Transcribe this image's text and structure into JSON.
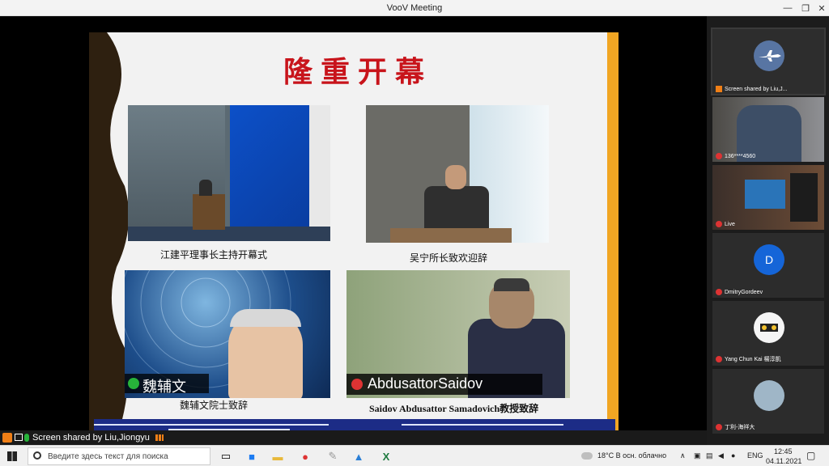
{
  "window": {
    "title": "VooV Meeting",
    "minimize": "—",
    "restore": "❐",
    "close": "✕"
  },
  "slide": {
    "title": "隆重开幕",
    "captions": [
      "江建平理事长主持开幕式",
      "吴宁所长致欢迎辞",
      "魏辅文院士致辞",
      "Saidov Abdusattor Samadovich教授致辞"
    ],
    "name_tags": [
      "魏辅文",
      "AbdusattorSaidov"
    ]
  },
  "share_bar": {
    "label": "Screen shared by Liu,Jiongyu"
  },
  "participants": [
    {
      "name": "Screen shared by Liu,J...",
      "kind": "plane"
    },
    {
      "name": "136****4560",
      "kind": "video"
    },
    {
      "name": "Live",
      "kind": "room"
    },
    {
      "name": "DmitryGordeev",
      "kind": "initial",
      "initial": "D",
      "color": "#1565d8"
    },
    {
      "name": "Yang Chun Kai 楊淳凱",
      "kind": "logo"
    },
    {
      "name": "丁利-海祥大",
      "kind": "photo"
    }
  ],
  "taskbar": {
    "search_placeholder": "Введите здесь текст для поиска",
    "weather": "18°C  В осн. облачно",
    "lang": "ENG",
    "time": "12:45",
    "date": "04.11.2021"
  },
  "colors": {
    "title_red": "#c8141b",
    "accent_orange": "#f1a623",
    "band_blue": "#1c2c86"
  }
}
